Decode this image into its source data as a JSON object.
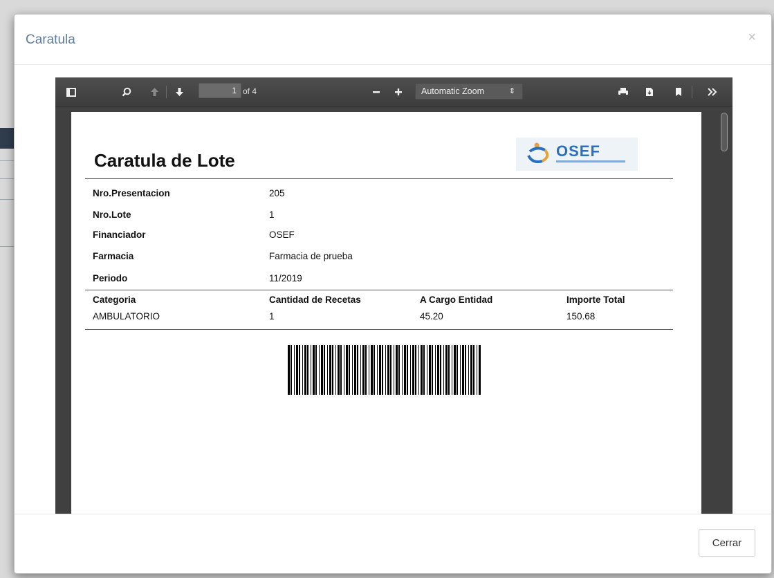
{
  "modal": {
    "title": "Caratula",
    "close_glyph": "×",
    "footer_button": "Cerrar"
  },
  "viewer_toolbar": {
    "page_current": "1",
    "page_total_label": "of 4",
    "zoom_label": "Automatic Zoom",
    "icons": [
      "sidebar-toggle-icon",
      "search-icon",
      "previous-page-icon",
      "next-page-icon",
      "zoom-out-icon",
      "zoom-in-icon",
      "print-icon",
      "download-icon",
      "bookmark-icon",
      "tools-icon"
    ]
  },
  "document": {
    "title": "Caratula de Lote",
    "logo_text": "OSEF",
    "fields": [
      {
        "label": "Nro.Presentacion",
        "value": "205"
      },
      {
        "label": "Nro.Lote",
        "value": "1"
      },
      {
        "label": "Financiador",
        "value": "OSEF"
      },
      {
        "label": "Farmacia",
        "value": "Farmacia de prueba"
      },
      {
        "label": "Periodo",
        "value": "11/2019"
      }
    ],
    "table": {
      "headers": [
        "Categoria",
        "Cantidad de Recetas",
        "A Cargo Entidad",
        "Importe Total"
      ],
      "rows": [
        [
          "AMBULATORIO",
          "1",
          "45.20",
          "150.68"
        ]
      ]
    }
  },
  "colors": {
    "title_blue": "#5f7ea0",
    "toolbar_dark": "#404040",
    "logo_blue": "#2b6fc1"
  }
}
